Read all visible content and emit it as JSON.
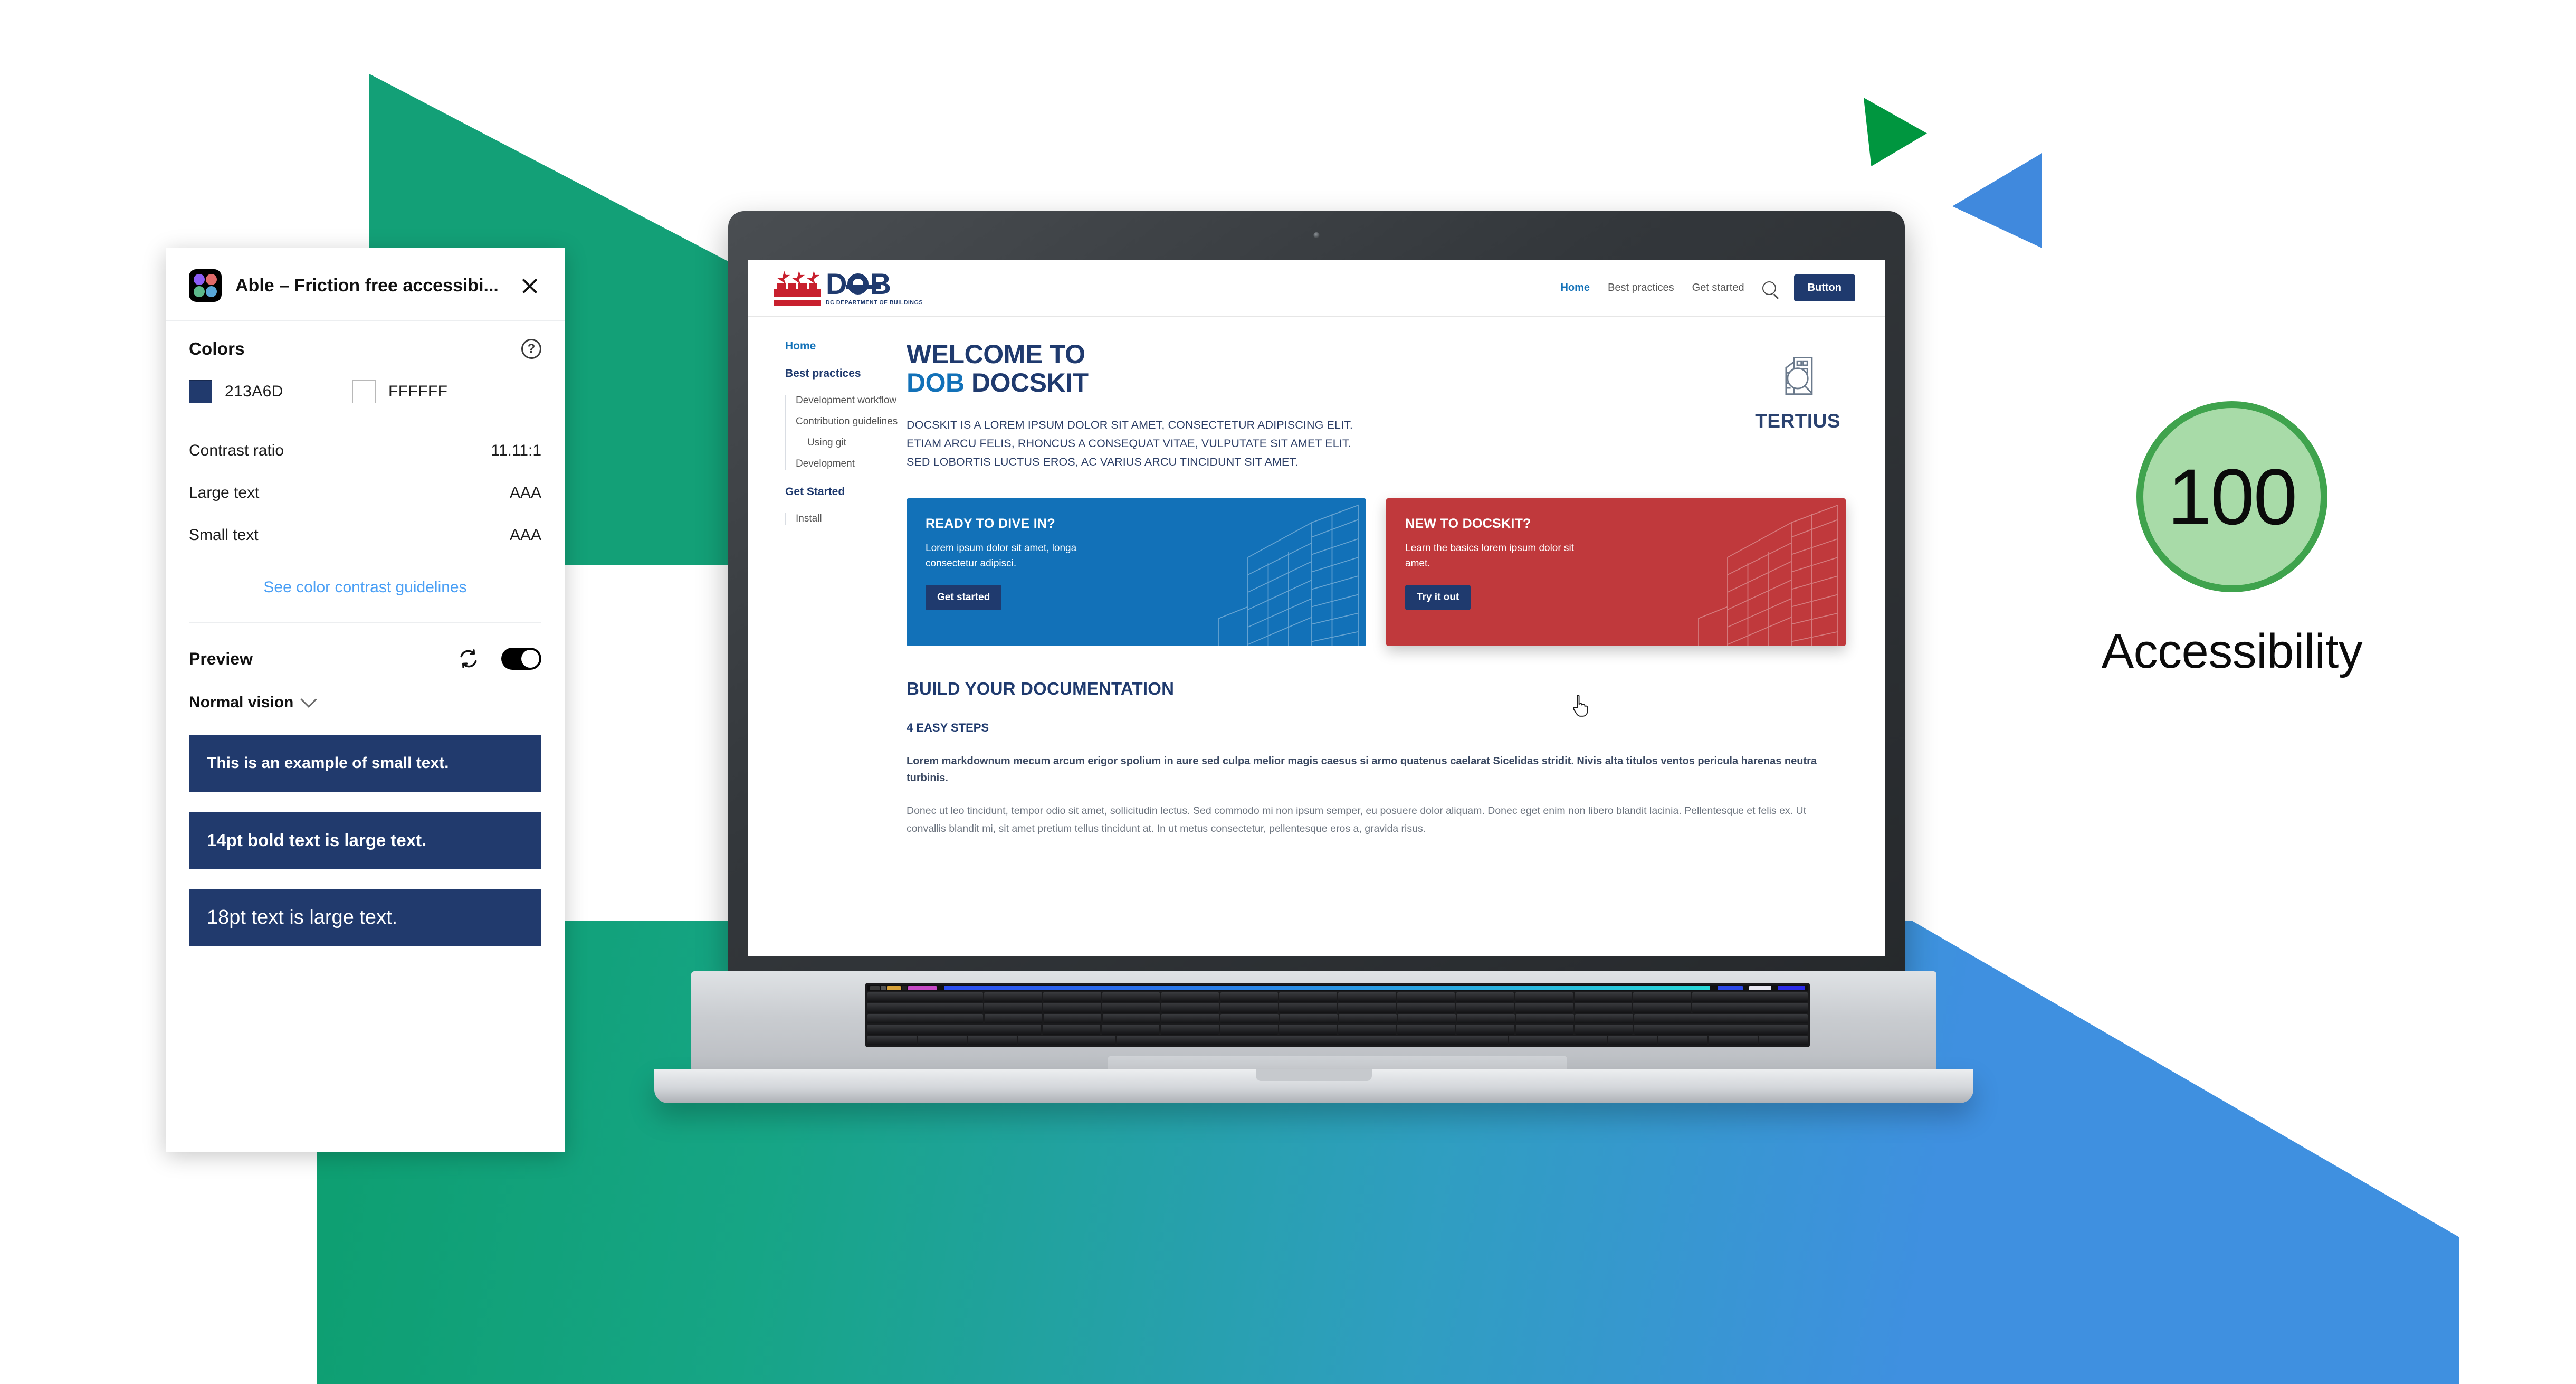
{
  "background": {
    "green_triangle_color": "#13a077",
    "gradient_start": "#0d9e6f",
    "gradient_end": "#3f90e0",
    "green_arrow_color": "#00963f",
    "blue_arrow_color": "#4089dd"
  },
  "able_panel": {
    "app_icon": "able-plugin-icon",
    "title": "Able – Friction free accessibi...",
    "close_label": "×",
    "colors": {
      "heading": "Colors",
      "help_glyph": "?",
      "foreground": {
        "hex_label": "213A6D",
        "hex": "#213A6D"
      },
      "background": {
        "hex_label": "FFFFFF",
        "hex": "#FFFFFF"
      }
    },
    "metrics": [
      {
        "label": "Contrast ratio",
        "value": "11.11:1"
      },
      {
        "label": "Large text",
        "value": "AAA"
      },
      {
        "label": "Small text",
        "value": "AAA"
      }
    ],
    "guidelines_link": "See color contrast guidelines",
    "preview": {
      "heading": "Preview",
      "refresh_icon": "refresh-icon",
      "toggle_state": "on",
      "vision_mode": "Normal vision",
      "samples": [
        "This is an example of small text.",
        "14pt bold text is large text.",
        "18pt text is large text."
      ]
    }
  },
  "website": {
    "logo": {
      "name": "DOB",
      "tagline": "DC DEPARTMENT OF BUILDINGS"
    },
    "nav": {
      "links": [
        {
          "label": "Home",
          "active": true
        },
        {
          "label": "Best practices",
          "active": false
        },
        {
          "label": "Get started",
          "active": false
        }
      ],
      "search_icon": "search-icon",
      "button_label": "Button"
    },
    "sidebar": [
      {
        "label": "Home",
        "type": "head",
        "color": "blue"
      },
      {
        "label": "Best practices",
        "type": "head",
        "color": "navy"
      },
      {
        "label": "Development workflow",
        "type": "item"
      },
      {
        "label": "Contribution guidelines",
        "type": "item"
      },
      {
        "label": "Using git",
        "type": "item-indent"
      },
      {
        "label": "Development",
        "type": "item"
      },
      {
        "label": "Get Started",
        "type": "head",
        "color": "navy"
      },
      {
        "label": "Install",
        "type": "item"
      }
    ],
    "hero": {
      "title_line1": "WELCOME TO",
      "title_accent": "DOB",
      "title_rest": " DOCSKIT",
      "paragraph": "DOCSKIT IS A LOREM IPSUM DOLOR SIT AMET, CONSECTETUR ADIPISCING ELIT. ETIAM ARCU FELIS, RHONCUS A CONSEQUAT VITAE, VULPUTATE SIT AMET ELIT. SED LOBORTIS LUCTUS EROS, AC VARIUS ARCU TINCIDUNT SIT AMET."
    },
    "partner_logo": {
      "name": "TERTIUS",
      "mark": "building-magnifier-icon"
    },
    "cards": [
      {
        "title": "READY TO DIVE IN?",
        "body": "Lorem ipsum dolor sit amet, longa consectetur adipisci.",
        "button": "Get started",
        "color": "#1271b8"
      },
      {
        "title": "NEW TO DOCSKIT?",
        "body": "Learn the basics lorem ipsum dolor sit amet.",
        "button": "Try it out",
        "color": "#c0393c"
      }
    ],
    "build": {
      "title": "BUILD YOUR DOCUMENTATION",
      "subtitle": "4 EASY STEPS",
      "lead": "Lorem markdownum mecum arcum erigor spolium in aure sed culpa melior magis caesus si armo quatenus caelarat Sicelidas stridit. Nivis alta titulos ventos pericula harenas neutra turbinis.",
      "body": "Donec ut leo tincidunt, tempor odio sit amet, sollicitudin lectus. Sed commodo mi non ipsum semper, eu posuere dolor aliquam. Donec eget enim non libero blandit lacinia. Pellentesque et felis ex. Ut convallis blandit mi, sit amet pretium tellus tincidunt at. In ut metus consectetur, pellentesque eros a, gravida risus."
    }
  },
  "score_badge": {
    "value": "100",
    "label": "Accessibility",
    "fill_color": "#a8dba8",
    "ring_color": "#3fa34d"
  }
}
